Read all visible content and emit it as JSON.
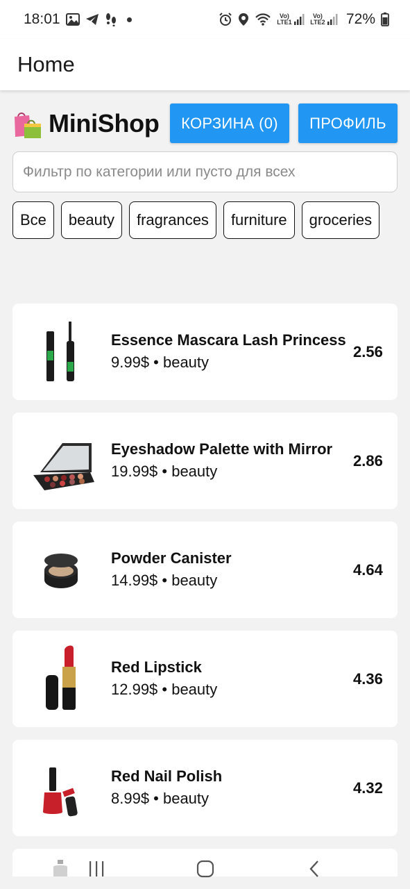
{
  "status_bar": {
    "time": "18:01",
    "lte1_label": "Vo) LTE1",
    "lte2_label": "Vo) LTE2",
    "battery": "72%"
  },
  "app_bar": {
    "title": "Home"
  },
  "header": {
    "logo_emoji": "shopping-bags-icon",
    "title": "MiniShop",
    "cart_button": "КОРЗИНА (0)",
    "profile_button": "ПРОФИЛЬ"
  },
  "filter": {
    "value": "",
    "placeholder": "Фильтр по категории или пусто для всех"
  },
  "chips": [
    "Все",
    "beauty",
    "fragrances",
    "furniture",
    "groceries"
  ],
  "products": [
    {
      "name": "Essence Mascara Lash Princess",
      "meta": "9.99$ • beauty",
      "rating": "2.56",
      "icon": "mascara-icon"
    },
    {
      "name": "Eyeshadow Palette with Mirror",
      "meta": "19.99$ • beauty",
      "rating": "2.86",
      "icon": "eyeshadow-palette-icon"
    },
    {
      "name": "Powder Canister",
      "meta": "14.99$ • beauty",
      "rating": "4.64",
      "icon": "powder-canister-icon"
    },
    {
      "name": "Red Lipstick",
      "meta": "12.99$ • beauty",
      "rating": "4.36",
      "icon": "lipstick-icon"
    },
    {
      "name": "Red Nail Polish",
      "meta": "8.99$ • beauty",
      "rating": "4.32",
      "icon": "nail-polish-icon"
    }
  ],
  "colors": {
    "accent": "#2196f3",
    "background": "#f2f2f2",
    "card": "#ffffff"
  }
}
